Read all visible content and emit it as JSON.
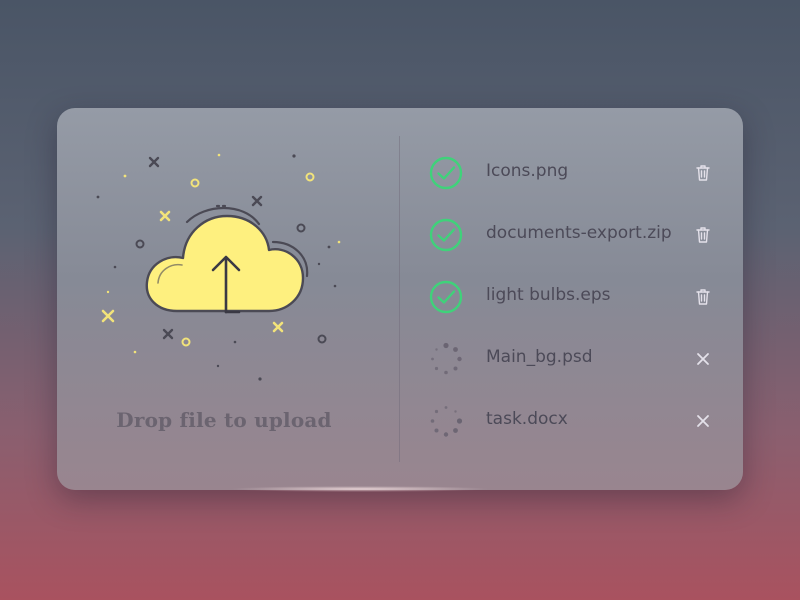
{
  "upload": {
    "label": "Drop file to upload",
    "icon": "cloud-upload-icon",
    "accent_color": "#fef07f"
  },
  "files": [
    {
      "name": "Icons.png",
      "status": "complete",
      "action": "delete"
    },
    {
      "name": "documents-export.zip",
      "status": "complete",
      "action": "delete"
    },
    {
      "name": "light bulbs.eps",
      "status": "complete",
      "action": "delete"
    },
    {
      "name": "Main_bg.psd",
      "status": "uploading",
      "action": "cancel"
    },
    {
      "name": "task.docx",
      "status": "uploading",
      "action": "cancel"
    }
  ],
  "colors": {
    "complete": "#3fd27a",
    "spinner": "#6a6472",
    "action_icon": "#e4e1ea"
  }
}
